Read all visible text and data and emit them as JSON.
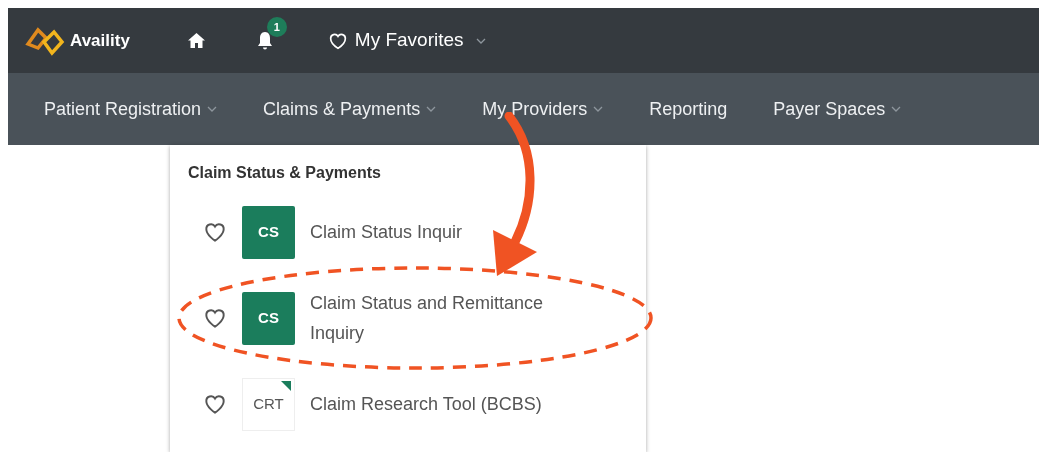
{
  "top_bar": {
    "logo_text": "Availity",
    "notification_count": "1",
    "favorites_label": "My Favorites"
  },
  "nav": [
    {
      "label": "Patient Registration",
      "dropdown": true
    },
    {
      "label": "Claims & Payments",
      "dropdown": true
    },
    {
      "label": "My Providers",
      "dropdown": true
    },
    {
      "label": "Reporting",
      "dropdown": false
    },
    {
      "label": "Payer Spaces",
      "dropdown": true
    }
  ],
  "menu": {
    "heading": "Claim Status & Payments",
    "items": [
      {
        "badge": "CS",
        "kind": "filled",
        "label": "Claim Status Inquir",
        "favorite": false,
        "circled": false
      },
      {
        "badge": "CS",
        "kind": "filled",
        "label": "Claim Status and Remittance Inquiry",
        "favorite": false,
        "circled": true
      },
      {
        "badge": "CRT",
        "kind": "outlined",
        "label": "Claim Research Tool (BCBS)",
        "favorite": false,
        "circled": false
      }
    ]
  }
}
